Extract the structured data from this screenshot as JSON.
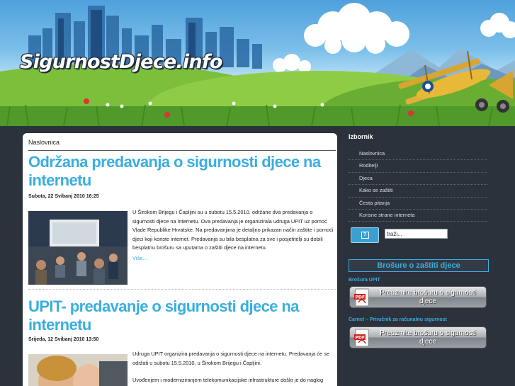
{
  "site": {
    "logo_text": "SigurnostDjece.info"
  },
  "breadcrumb": "Naslovnica",
  "posts": [
    {
      "title": "Održana predavanja o sigurnosti djece na internetu",
      "date": "Subota, 22 Svibanj 2010 16:25",
      "text": "U Širokom Brijegu i Čapljini su u subotu 15.5.2010. održane dva predavanja o sigurnosti djece na internetu. Ova predavanja je organizirala udruga UPIT uz pomoć Vlade Republike Hrvatske. Na predavanjima je detaljno prikazan način zaštite i pomoći djeci koji koriste internet.  Predavanja su bila besplatna za sve i  posjetitelji su dobili besplatnu brošuru sa uputama o zaštiti djece na internetu.",
      "more": "Više..."
    },
    {
      "title": "UPIT- predavanje o sigurnosti djece na internetu",
      "date": "Srijeda, 12 Svibanj 2010 13:50",
      "text1": "Udruga UPIT organizira predavanja o sigurnosti djece na internetu. Predavanja će se održati u subotu 15.5.2010. u Širokom Brijegu i Čapljini.",
      "text2": "Uvođenjem i moderniziranjem telekomunikacijske infrastrukture došlo je do naglog porasta korisnika interneta. Prema Vašoj statistici, koju je provela udruga IT sigurnosti"
    }
  ],
  "sidebar": {
    "menu_title": "Izbornik",
    "menu": [
      "Naslovnica",
      "Roditelji",
      "Djeca",
      "Kako se zaštiti",
      "Česta pitanja",
      "Korisne strane interneta"
    ],
    "search_button": "?",
    "search_value": "traži...",
    "brosure_title": "Brošure o zaštiti djece",
    "brosure_1_label": "Brošura UPIT",
    "brosure_2_label": "Carnet – Priručnik za računalnu sigurnost",
    "download_text": "Preuzmite brošuru o sigurnosti djece",
    "pdf_icon_text": "PDF"
  },
  "colors": {
    "accent": "#3aaee0",
    "background": "#2b323c",
    "content": "#ffffff"
  }
}
